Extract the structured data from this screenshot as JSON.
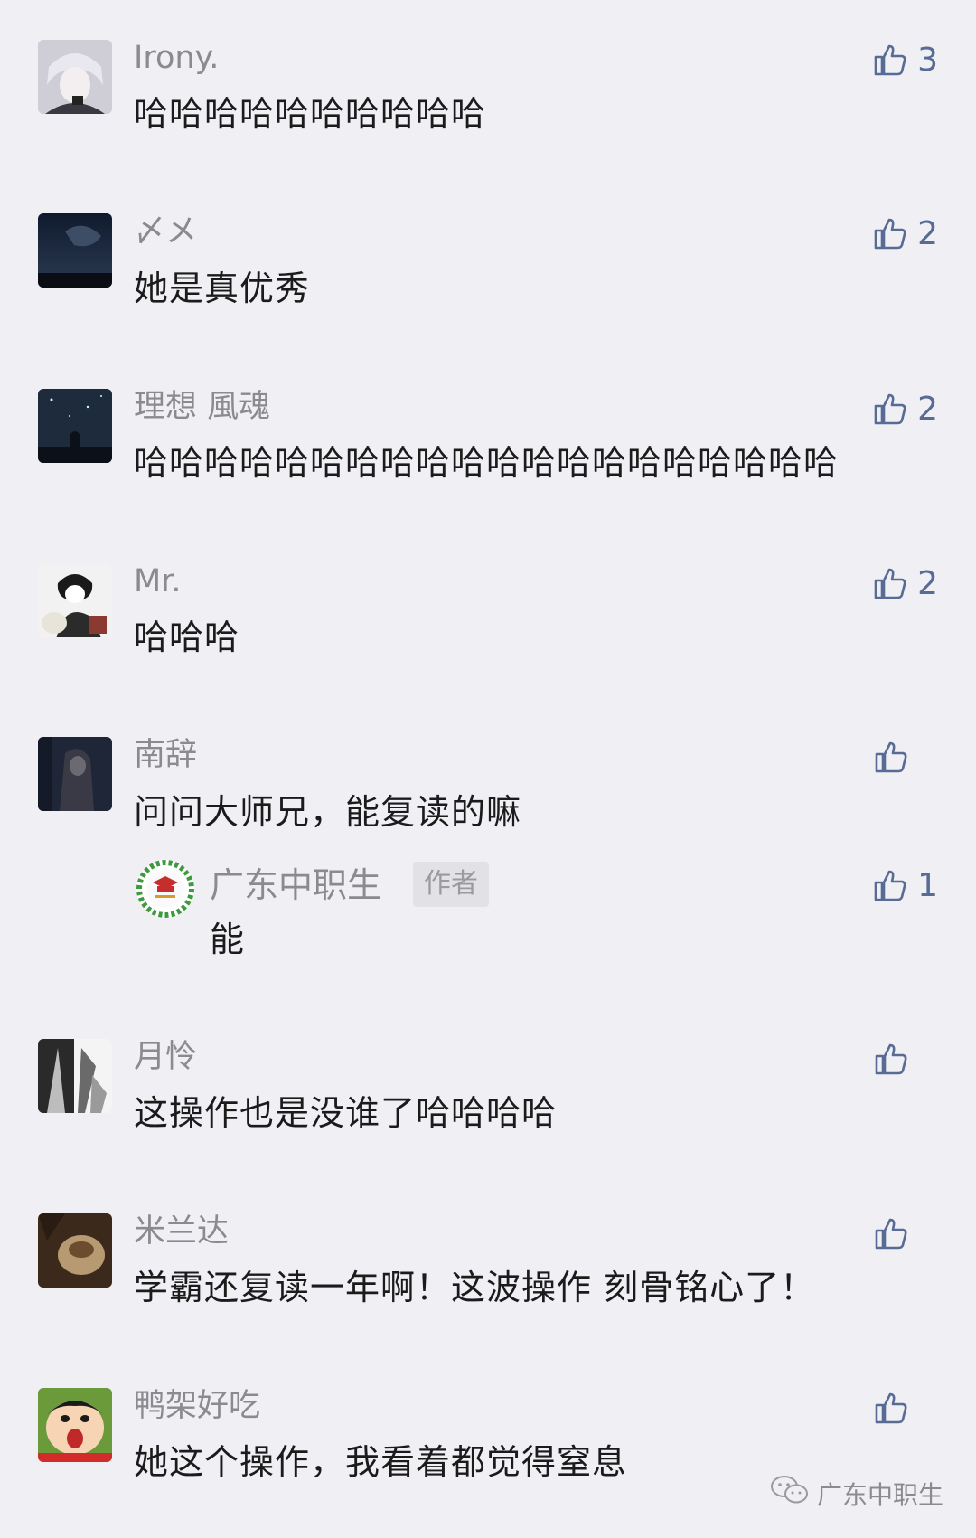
{
  "comments": [
    {
      "name": "Irony.",
      "text": "哈哈哈哈哈哈哈哈哈哈",
      "likes": "3",
      "avatar_icon": "anime-boy-avatar"
    },
    {
      "name": "〆メ",
      "text": "她是真优秀",
      "likes": "2",
      "avatar_icon": "night-sky-avatar"
    },
    {
      "name": "理想 風魂",
      "text": "哈哈哈哈哈哈哈哈哈哈哈哈哈哈哈哈哈哈哈哈",
      "likes": "2",
      "avatar_icon": "starry-sky-silhouette-avatar"
    },
    {
      "name": "Mr.",
      "text": "哈哈哈",
      "likes": "2",
      "avatar_icon": "anime-sketch-avatar"
    },
    {
      "name": "南辞",
      "text": "问问大师兄，能复读的嘛",
      "likes": "",
      "avatar_icon": "dark-figure-avatar",
      "reply": {
        "name": "广东中职生",
        "tag": "作者",
        "text": "能",
        "likes": "1",
        "avatar_icon": "school-laurel-logo-avatar"
      }
    },
    {
      "name": "月怜",
      "text": "这操作也是没谁了哈哈哈哈",
      "likes": "",
      "avatar_icon": "ink-sketch-avatar"
    },
    {
      "name": "米兰达",
      "text": "学霸还复读一年啊！这波操作 刻骨铭心了！",
      "likes": "",
      "avatar_icon": "pottery-avatar"
    },
    {
      "name": "鸭架好吃",
      "text": "她这个操作，我看着都觉得窒息",
      "likes": "",
      "avatar_icon": "crayon-shinchan-avatar"
    }
  ],
  "watermark": {
    "text": "广东中职生",
    "icon": "wechat-icon"
  },
  "colors": {
    "background": "#efeff4",
    "like_blue": "#576b95",
    "name_gray": "#8a8a8f"
  }
}
